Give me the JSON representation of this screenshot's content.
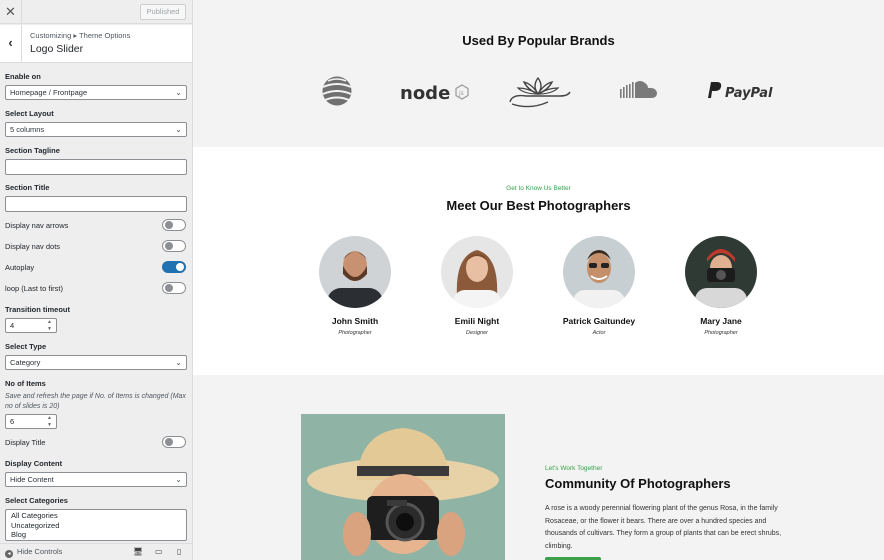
{
  "panel": {
    "close_icon": "close-icon",
    "published_label": "Published",
    "breadcrumb": "Customizing ▸ Theme Options",
    "section_title": "Logo Slider",
    "controls": {
      "enable_on": {
        "label": "Enable on",
        "value": "Homepage / Frontpage"
      },
      "select_layout": {
        "label": "Select Layout",
        "value": "5 columns"
      },
      "section_tagline": {
        "label": "Section Tagline",
        "value": ""
      },
      "section_title": {
        "label": "Section Title",
        "value": ""
      },
      "nav_arrows": {
        "label": "Display nav arrows",
        "on": false
      },
      "nav_dots": {
        "label": "Display nav dots",
        "on": false
      },
      "autoplay": {
        "label": "Autoplay",
        "on": true
      },
      "loop": {
        "label": "loop (Last to first)",
        "on": false
      },
      "transition_timeout": {
        "label": "Transition timeout",
        "value": "4"
      },
      "select_type": {
        "label": "Select Type",
        "value": "Category"
      },
      "no_of_items": {
        "label": "No of Items",
        "help": "Save and refresh the page if No. of Items is changed (Max no of slides is 20)",
        "value": "6"
      },
      "display_title": {
        "label": "Display Title",
        "on": false
      },
      "display_content": {
        "label": "Display Content",
        "value": "Hide Content"
      },
      "select_categories": {
        "label": "Select Categories",
        "options": [
          "All Categories",
          "Uncategorized",
          "Blog"
        ]
      }
    },
    "footer": {
      "hide_controls_label": "Hide Controls"
    }
  },
  "preview": {
    "brands": {
      "title": "Used By Popular Brands",
      "logos": [
        {
          "icon": "globe-logo-icon"
        },
        {
          "text": "node",
          "icon": "nodejs-logo-icon"
        },
        {
          "icon": "lotus-logo-icon"
        },
        {
          "icon": "soundcloud-logo-icon"
        },
        {
          "text": "PayPal",
          "icon": "paypal-logo-icon"
        }
      ]
    },
    "photographers": {
      "tagline": "Get to Know Us Better",
      "title": "Meet Our Best Photographers",
      "people": [
        {
          "name": "John Smith",
          "role": "Photographer"
        },
        {
          "name": "Emili Night",
          "role": "Designer"
        },
        {
          "name": "Patrick Gaitundey",
          "role": "Actor"
        },
        {
          "name": "Mary Jane",
          "role": "Photographer"
        }
      ]
    },
    "community": {
      "tagline": "Let's Work Together",
      "title": "Community Of Photographers",
      "text": "A rose is a woody perennial flowering plant of the genus Rosa, in the family Rosaceae, or the flower it bears. There are over a hundred species and thousands of cultivars. They form a group of plants that can be erect shrubs, climbing."
    }
  },
  "colors": {
    "accent_blue": "#2271b1",
    "accent_green": "#3aa04a",
    "panel_bg": "#eeeeee"
  }
}
